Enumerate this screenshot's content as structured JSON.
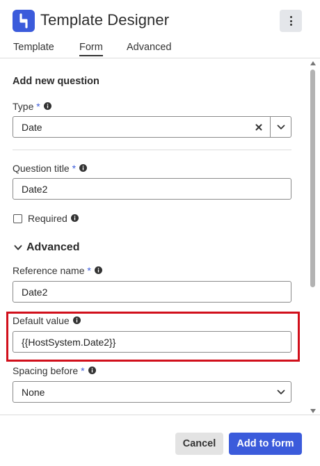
{
  "app": {
    "title": "Template Designer"
  },
  "tabs": [
    {
      "label": "Template"
    },
    {
      "label": "Form"
    },
    {
      "label": "Advanced"
    }
  ],
  "active_tab": "Form",
  "form": {
    "section_title": "Add new question",
    "type": {
      "label": "Type",
      "required_mark": "*",
      "value": "Date"
    },
    "question_title": {
      "label": "Question title",
      "required_mark": "*",
      "value": "Date2"
    },
    "required": {
      "label": "Required",
      "checked": false
    },
    "advanced": {
      "title": "Advanced",
      "expanded": true
    },
    "reference_name": {
      "label": "Reference name",
      "required_mark": "*",
      "value": "Date2"
    },
    "default_value": {
      "label": "Default value",
      "value": "{{HostSystem.Date2}}",
      "highlighted": true
    },
    "spacing_before": {
      "label": "Spacing before",
      "required_mark": "*",
      "value": "None"
    }
  },
  "footer": {
    "cancel_label": "Cancel",
    "add_label": "Add to form"
  },
  "colors": {
    "accent": "#3b5bdb",
    "highlight": "#d10f1b"
  },
  "icons": [
    "app-logo-icon",
    "more-vertical-icon",
    "info-icon",
    "clear-icon",
    "chevron-down-icon",
    "scroll-up-icon",
    "scroll-down-icon"
  ]
}
